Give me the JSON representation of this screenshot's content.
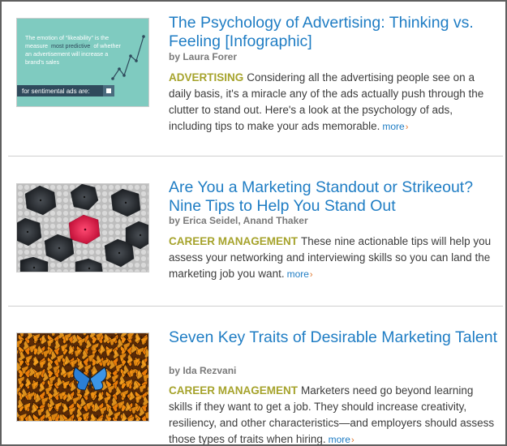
{
  "articles": [
    {
      "title": "The Psychology of Advertising: Thinking vs. Feeling [Infographic]",
      "byline": "by Laura Forer",
      "category": "ADVERTISING",
      "summary": "Considering all the advertising people see on a daily basis, it's a miracle any of the ads actually push through the clutter to stand out. Here's a look at the psychology of ads, including tips to make your ads memorable.",
      "more": "more",
      "more_icon": "chevron-right-icon",
      "thumbnail": {
        "line1": "The emotion of “likeability” is the",
        "line2_a": "measure",
        "line2_b": "most predictive",
        "line2_c": "of whether",
        "line3": "an advertisement will increase a",
        "line4": "brand's sales",
        "banner": "for sentimental ads are:",
        "bg_color": "#7fcbc0"
      }
    },
    {
      "title": "Are You a Marketing Standout or Strikeout? Nine Tips to Help You Stand Out",
      "byline": "by Erica Seidel, Anand Thaker",
      "category": "CAREER MANAGEMENT",
      "summary": "These nine actionable tips will help you assess your networking and interviewing skills so you can land the marketing job you want.",
      "more": "more",
      "more_icon": "chevron-right-icon"
    },
    {
      "title": "Seven Key Traits of Desirable Marketing Talent",
      "byline": "by Ida Rezvani",
      "category": "CAREER MANAGEMENT",
      "summary": "Marketers need go beyond learning skills if they want to get a job. They should increase creativity, resiliency, and other characteristics—and employers should assess those types of traits when hiring.",
      "more": "more",
      "more_icon": "chevron-right-icon"
    }
  ],
  "colors": {
    "title": "#1f7dc4",
    "category": "#a6a32c",
    "more_chevron": "#e0752b"
  }
}
